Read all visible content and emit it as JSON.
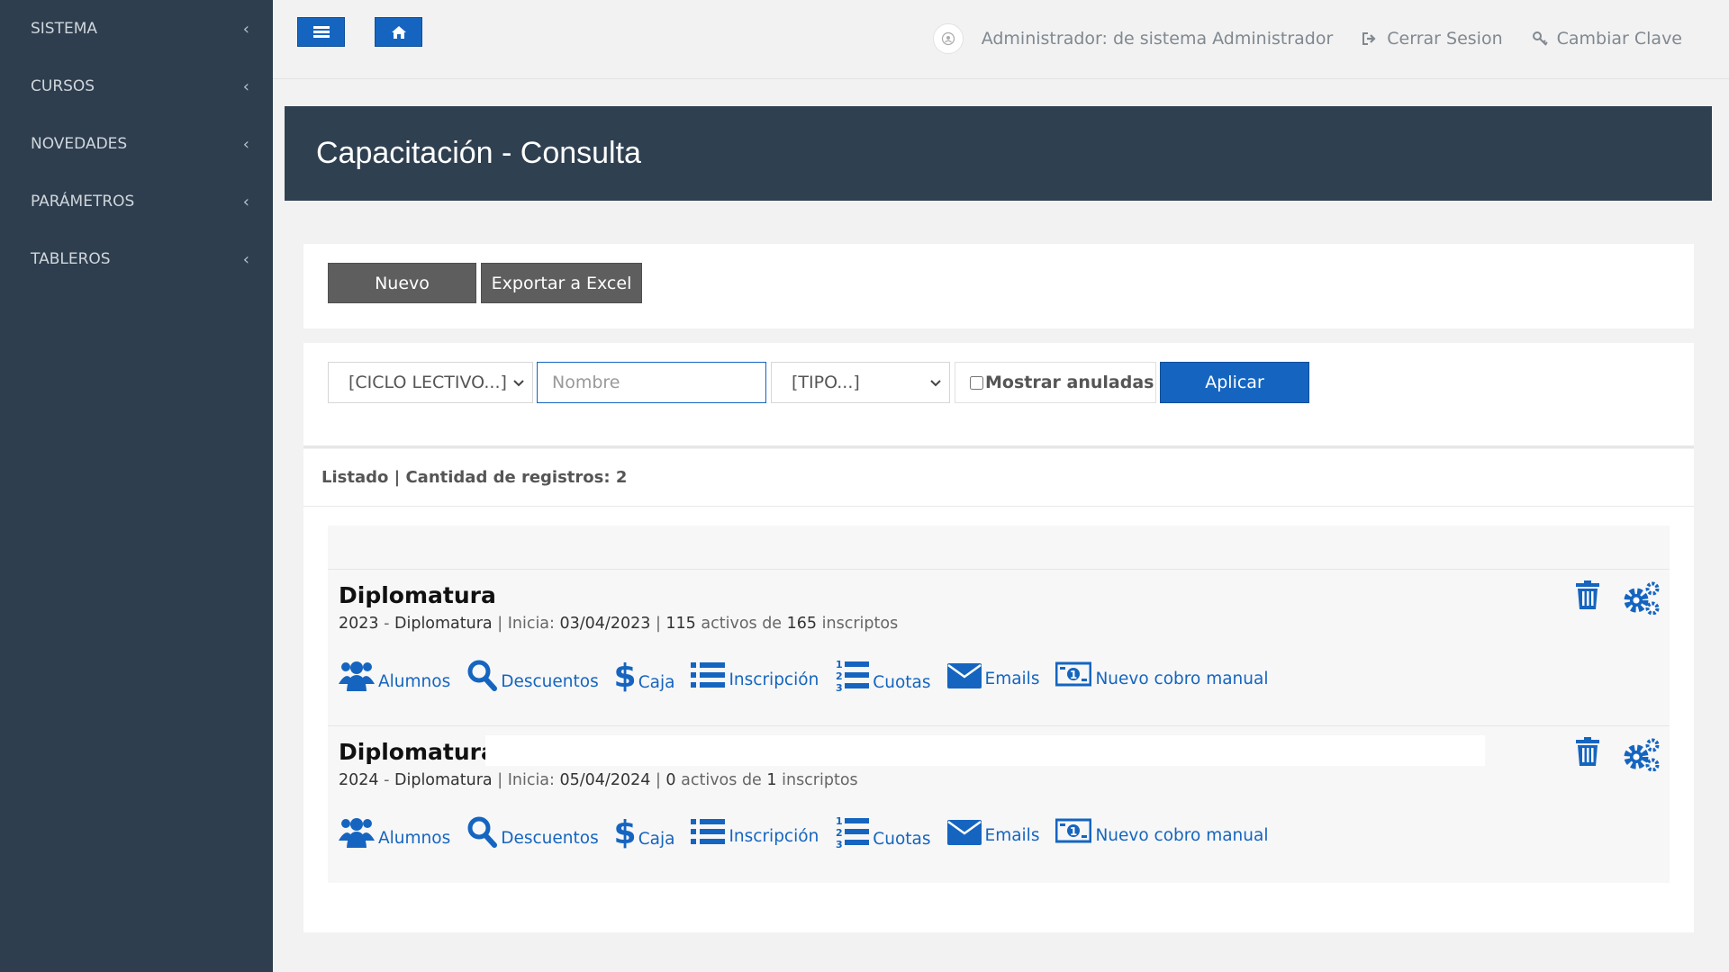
{
  "sidebar": {
    "items": [
      {
        "label": "SISTEMA"
      },
      {
        "label": "CURSOS"
      },
      {
        "label": "NOVEDADES"
      },
      {
        "label": "PARÁMETROS"
      },
      {
        "label": "TABLEROS"
      }
    ]
  },
  "topbar": {
    "user_label": "Administrador: de sistema Administrador",
    "logout_label": "Cerrar Sesion",
    "change_password_label": "Cambiar Clave"
  },
  "page": {
    "title": "Capacitación - Consulta"
  },
  "actions": {
    "new_label": "Nuevo",
    "export_label": "Exportar a Excel"
  },
  "filters": {
    "ciclo_lectivo": "[CICLO LECTIVO...]",
    "nombre_placeholder": "Nombre",
    "tipo": "[TIPO...]",
    "show_cancelled_label": "Mostrar anuladas",
    "apply_label": "Aplicar"
  },
  "list": {
    "header": "Listado | Cantidad de registros: 2",
    "items": [
      {
        "title": "Diplomatura",
        "year": "2023",
        "type": "Diplomatura",
        "start_label": "Inicia:",
        "start_date": "03/04/2023",
        "active": "115",
        "active_label": "activos de",
        "enrolled": "165",
        "enrolled_label": "inscriptos"
      },
      {
        "title": "Diplomatura",
        "year": "2024",
        "type": "Diplomatura",
        "start_label": "Inicia:",
        "start_date": "05/04/2024",
        "active": "0",
        "active_label": "activos de",
        "enrolled": "1",
        "enrolled_label": "inscriptos"
      }
    ],
    "actions": {
      "alumnos": "Alumnos",
      "descuentos": "Descuentos",
      "caja": "Caja",
      "inscripcion": "Inscripción",
      "cuotas": "Cuotas",
      "emails": "Emails",
      "cobro": "Nuevo cobro manual"
    }
  },
  "colors": {
    "sidebar_bg": "#2e3e4e",
    "banner_bg": "#2f4051",
    "accent": "#1565c0",
    "dark_button": "#5e5e5e"
  },
  "icons": [
    "bars-icon",
    "home-icon",
    "sign-out-icon",
    "key-icon",
    "chevron-left-icon",
    "chevron-down-icon",
    "users-icon",
    "search-icon",
    "dollar-icon",
    "list-icon",
    "numbered-list-icon",
    "envelope-icon",
    "money-icon",
    "trash-icon",
    "cogs-icon"
  ]
}
